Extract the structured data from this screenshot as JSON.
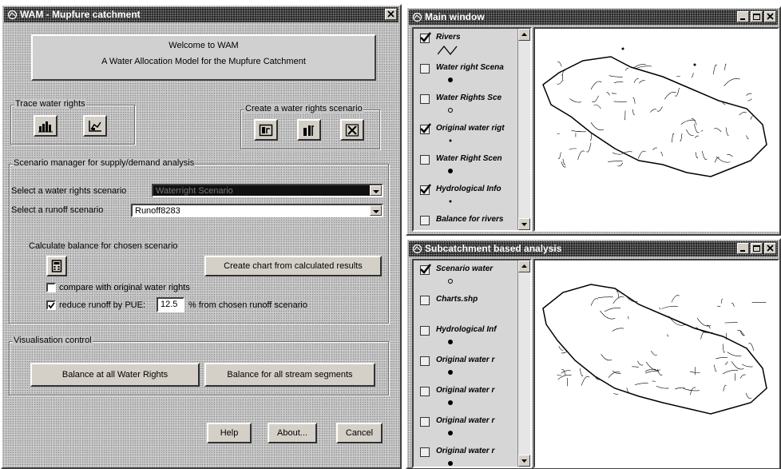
{
  "left_window": {
    "title": "WAM - Mupfure catchment",
    "welcome": {
      "line1": "Welcome to WAM",
      "line2": "A Water Allocation Model for the Mupfure Catchment"
    },
    "trace": {
      "title": "Trace water rights"
    },
    "create": {
      "title": "Create a water rights scenario"
    },
    "scenario": {
      "title": "Scenario manager for supply/demand analysis",
      "select_rights_label": "Select a water rights scenario",
      "select_rights_value": "Waterright Scenario",
      "select_runoff_label": "Select a runoff scenario",
      "select_runoff_value": "Runoff8283",
      "calc_label": "Calculate balance for chosen scenario",
      "chart_button": "Create chart from calculated results",
      "compare_label": "compare with original water rights",
      "compare_checked": false,
      "reduce_label": "reduce runoff by PUE:",
      "reduce_checked": true,
      "pue_value": "12.5",
      "pue_suffix": "% from chosen runoff scenario"
    },
    "visualisation": {
      "title": "Visualisation control",
      "balance_water_rights": "Balance at all Water Rights",
      "balance_stream_segments": "Balance for all stream segments"
    },
    "buttons": {
      "help": "Help",
      "about": "About...",
      "cancel": "Cancel"
    }
  },
  "main_window": {
    "title": "Main window",
    "layers": [
      {
        "label": "Rivers",
        "checked": true,
        "symbol": "line"
      },
      {
        "label": "Water right Scena",
        "checked": false,
        "symbol": "dot"
      },
      {
        "label": "Water Rights Sce",
        "checked": false,
        "symbol": "circle"
      },
      {
        "label": "Original water rigt",
        "checked": true,
        "symbol": "small-dot"
      },
      {
        "label": "Water Right Scen",
        "checked": false,
        "symbol": "dot"
      },
      {
        "label": "Hydrological Info",
        "checked": true,
        "symbol": "small-dot"
      },
      {
        "label": "Balance for rivers",
        "checked": false,
        "symbol": "none"
      }
    ]
  },
  "sub_window": {
    "title": "Subcatchment based analysis",
    "layers": [
      {
        "label": "Scenario water",
        "checked": true,
        "symbol": "circle"
      },
      {
        "label": "Charts.shp",
        "checked": false,
        "symbol": "none"
      },
      {
        "label": "Hydrological Inf",
        "checked": false,
        "symbol": "dot"
      },
      {
        "label": "Original water r",
        "checked": false,
        "symbol": "dot"
      },
      {
        "label": "Original water r",
        "checked": false,
        "symbol": "dot"
      },
      {
        "label": "Original water r",
        "checked": false,
        "symbol": "dot"
      },
      {
        "label": "Original water r",
        "checked": false,
        "symbol": "dot"
      }
    ]
  },
  "colors": {
    "dialog_gray": "#c6c6c6",
    "titlebar_dark": "#303030",
    "selected_highlight": "#101010"
  }
}
